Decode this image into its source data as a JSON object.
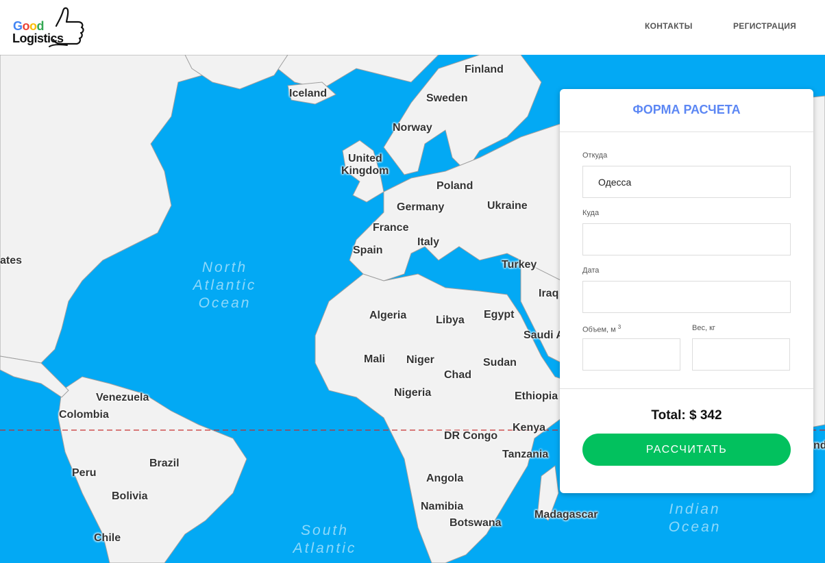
{
  "header": {
    "logo_word1": "Good",
    "logo_word2": "Logistics",
    "nav": {
      "contacts": "КОНТАКТЫ",
      "register": "РЕГИСТРАЦИЯ"
    }
  },
  "map": {
    "countries": {
      "finland": "Finland",
      "iceland": "Iceland",
      "sweden": "Sweden",
      "norway": "Norway",
      "uk1": "United",
      "uk2": "Kingdom",
      "poland": "Poland",
      "germany": "Germany",
      "ukraine": "Ukraine",
      "france": "France",
      "italy": "Italy",
      "spain": "Spain",
      "turkey": "Turkey",
      "iraq": "Iraq",
      "states": "ates",
      "algeria": "Algeria",
      "libya": "Libya",
      "egypt": "Egypt",
      "saudi": "Saudi A",
      "mali": "Mali",
      "niger": "Niger",
      "sudan": "Sudan",
      "chad": "Chad",
      "nigeria": "Nigeria",
      "ethiopia": "Ethiopia",
      "venezuela": "Venezuela",
      "colombia": "Colombia",
      "drcongo": "DR Congo",
      "kenya": "Kenya",
      "tanzania": "Tanzania",
      "brazil": "Brazil",
      "peru": "Peru",
      "angola": "Angola",
      "bolivia": "Bolivia",
      "namibia": "Namibia",
      "botswana": "Botswana",
      "madagascar": "Madagascar",
      "chile": "Chile",
      "nd": "nd"
    },
    "oceans": {
      "north_atlantic": "North Atlantic Ocean",
      "south_atlantic": "South Atlantic",
      "indian": "Indian Ocean"
    }
  },
  "form": {
    "title": "ФОРМА РАСЧЕТА",
    "from_label": "Откуда",
    "from_value": "Одесса",
    "to_label": "Куда",
    "date_label": "Дата",
    "volume_label": "Объем, м",
    "volume_sup": "3",
    "weight_label": "Вес, кг",
    "total": "Total: $ 342",
    "submit_label": "РАССЧИТАТЬ"
  },
  "colors": {
    "ocean": "#03a9f4",
    "title": "#5c87f4",
    "button": "#02c15e"
  }
}
